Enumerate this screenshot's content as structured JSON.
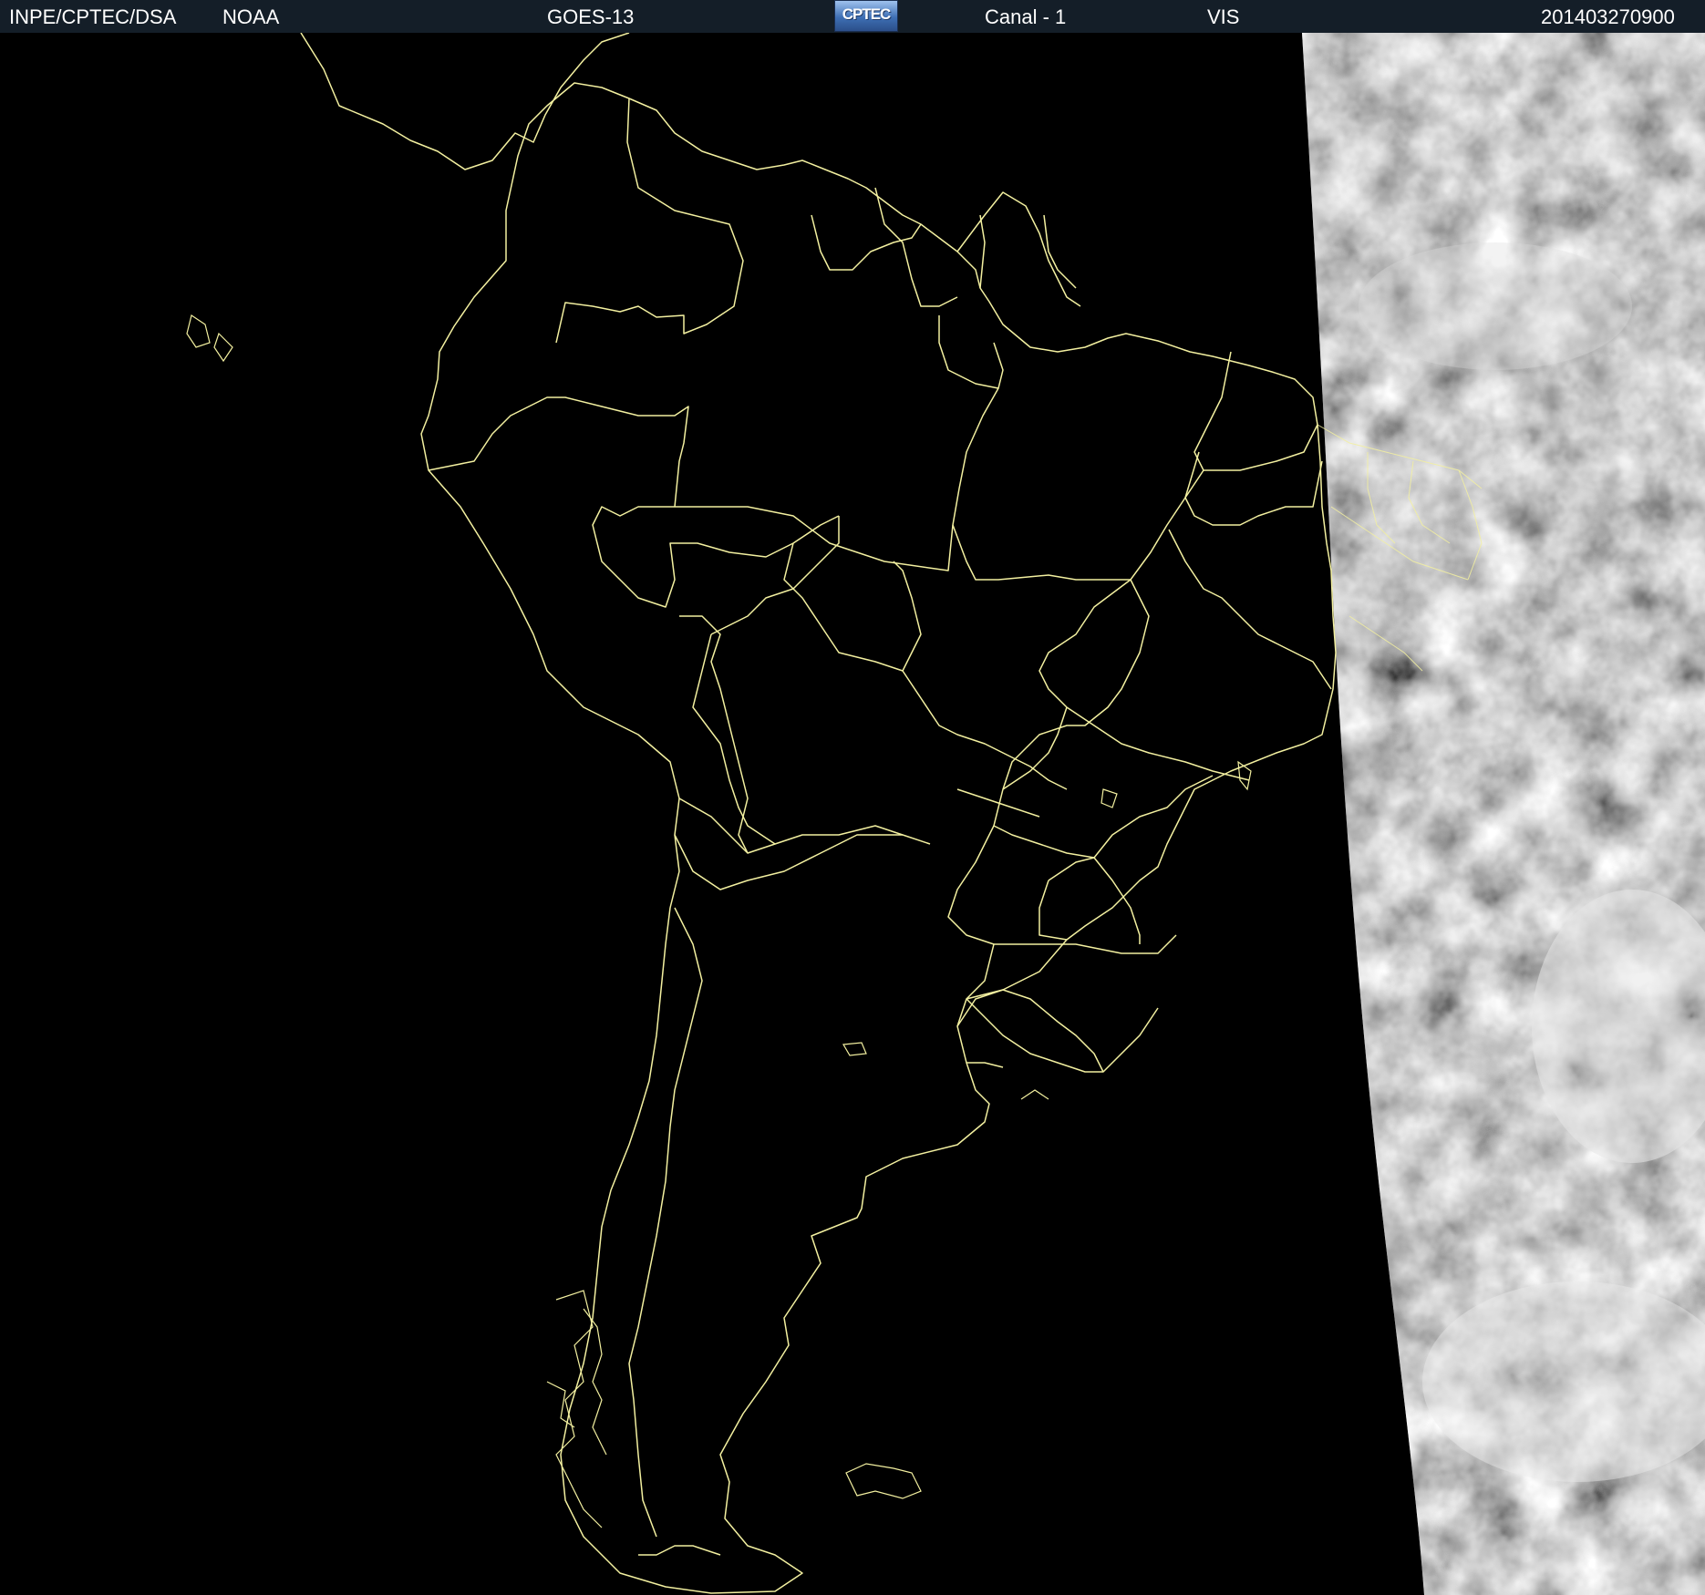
{
  "header": {
    "agency": "INPE/CPTEC/DSA",
    "provider": "NOAA",
    "satellite": "GOES-13",
    "logo_text": "CPTEC",
    "channel": "Canal - 1",
    "band": "VIS",
    "timestamp": "201403270900"
  },
  "colors": {
    "header_bg": "#141e28",
    "border_lines": "#f3f0a0",
    "space": "#000000",
    "cloud_base": "#808080"
  },
  "map": {
    "region": "South America",
    "icons": [
      "cptec-logo",
      "country-borders",
      "state-borders",
      "cloud-imagery"
    ]
  }
}
